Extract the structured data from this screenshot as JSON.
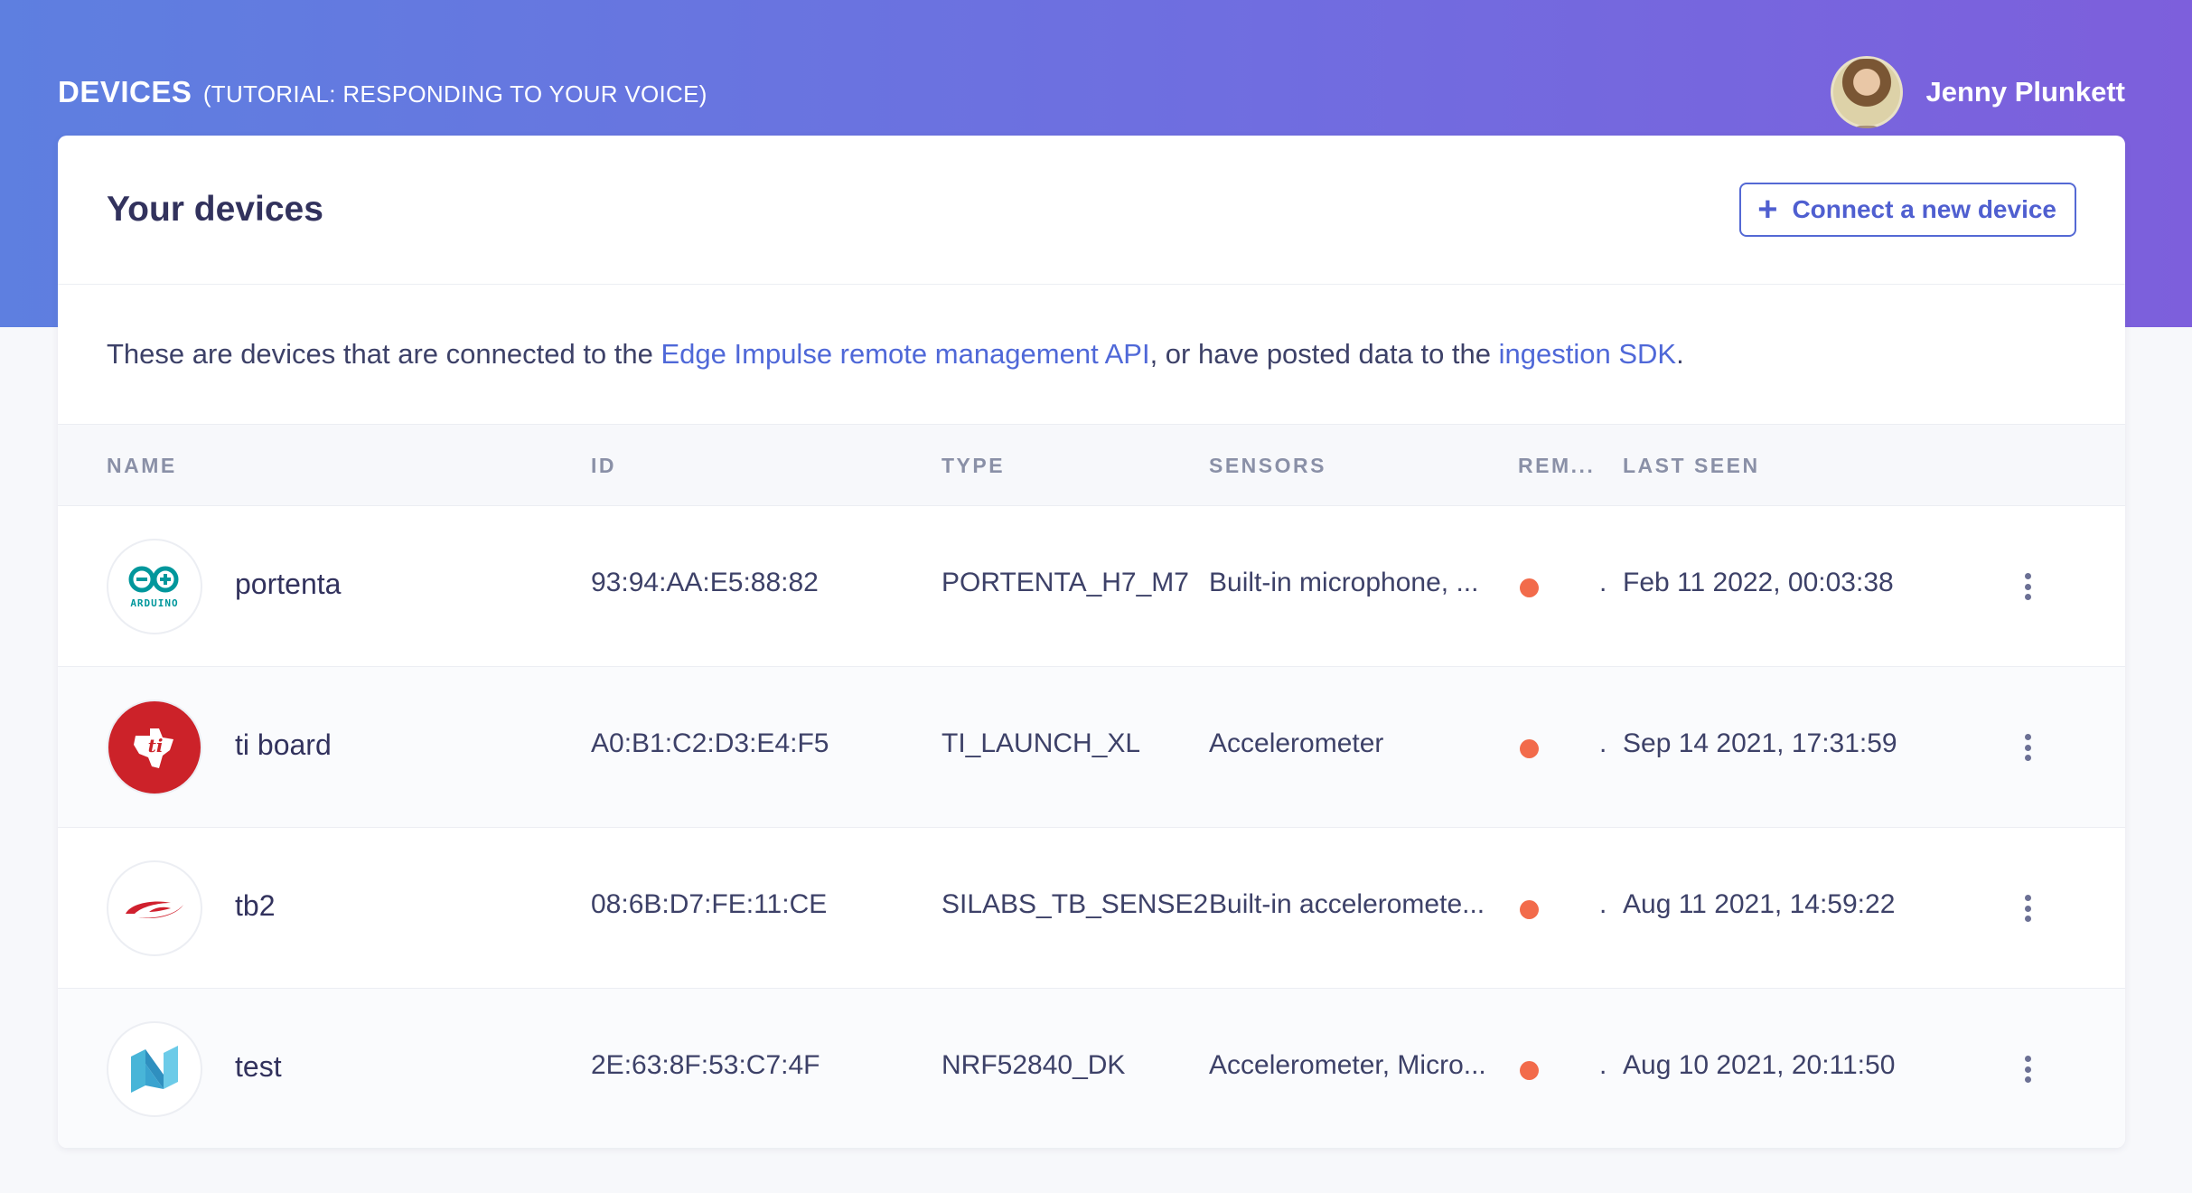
{
  "header": {
    "title": "DEVICES",
    "subtitle": "(TUTORIAL: RESPONDING TO YOUR VOICE)",
    "user_name": "Jenny Plunkett"
  },
  "card": {
    "title": "Your devices",
    "connect_label": "Connect a new device",
    "description": {
      "part1": "These are devices that are connected to the ",
      "link1": "Edge Impulse remote management API",
      "part2": ", or have posted data to the ",
      "link2": "ingestion SDK",
      "part3": "."
    }
  },
  "table": {
    "columns": [
      "NAME",
      "ID",
      "TYPE",
      "SENSORS",
      "REM...",
      "LAST SEEN"
    ],
    "rows": [
      {
        "logo": "arduino-logo",
        "name": "portenta",
        "id": "93:94:AA:E5:88:82",
        "type": "PORTENTA_H7_M7",
        "sensors": "Built-in microphone, ...",
        "last_seen": "Feb 11 2022, 00:03:38"
      },
      {
        "logo": "ti-logo",
        "name": "ti board",
        "id": "A0:B1:C2:D3:E4:F5",
        "type": "TI_LAUNCH_XL",
        "sensors": "Accelerometer",
        "last_seen": "Sep 14 2021, 17:31:59"
      },
      {
        "logo": "silabs-logo",
        "name": "tb2",
        "id": "08:6B:D7:FE:11:CE",
        "type": "SILABS_TB_SENSE2",
        "sensors": "Built-in acceleromete...",
        "last_seen": "Aug 11 2021, 14:59:22"
      },
      {
        "logo": "nordic-logo",
        "name": "test",
        "id": "2E:63:8F:53:C7:4F",
        "type": "NRF52840_DK",
        "sensors": "Accelerometer, Micro...",
        "last_seen": "Aug 10 2021, 20:11:50"
      }
    ],
    "separator": "."
  },
  "colors": {
    "accent": "#5469d4",
    "status_offline": "#f26b4b"
  }
}
